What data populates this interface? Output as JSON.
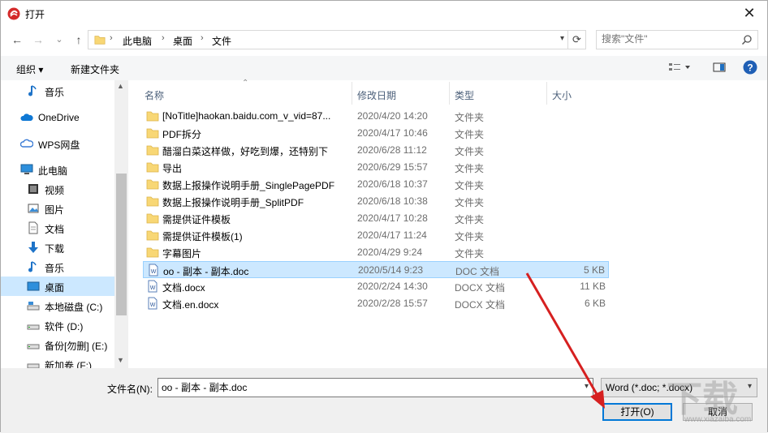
{
  "window": {
    "title": "打开",
    "close_glyph": "✕"
  },
  "nav_buttons": {
    "back": "←",
    "forward": "→",
    "recent": "⌄",
    "up": "↑"
  },
  "breadcrumb": [
    "此电脑",
    "桌面",
    "文件"
  ],
  "breadcrumb_sep": "›",
  "search": {
    "placeholder": "搜索\"文件\""
  },
  "toolbar": {
    "organize": "组织 ▾",
    "new_folder": "新建文件夹"
  },
  "nav_items": [
    {
      "label": "音乐",
      "icon": "music-icon"
    },
    {
      "label": "OneDrive",
      "icon": "cloud-icon"
    },
    {
      "label": "WPS网盘",
      "icon": "wps-cloud-icon"
    },
    {
      "label": "此电脑",
      "icon": "computer-icon"
    },
    {
      "label": "视频",
      "icon": "video-icon"
    },
    {
      "label": "图片",
      "icon": "pictures-icon"
    },
    {
      "label": "文档",
      "icon": "documents-icon"
    },
    {
      "label": "下载",
      "icon": "download-icon"
    },
    {
      "label": "音乐",
      "icon": "music-icon"
    },
    {
      "label": "桌面",
      "icon": "desktop-icon",
      "selected": true
    },
    {
      "label": "本地磁盘 (C:)",
      "icon": "drive-icon"
    },
    {
      "label": "软件 (D:)",
      "icon": "drive-icon"
    },
    {
      "label": "备份[勿删] (E:)",
      "icon": "drive-icon"
    },
    {
      "label": "新加卷 (F:)",
      "icon": "drive-icon"
    }
  ],
  "columns": {
    "name": "名称",
    "modified": "修改日期",
    "type": "类型",
    "size": "大小"
  },
  "files": [
    {
      "name": "[NoTitle]haokan.baidu.com_v_vid=87...",
      "date": "2020/4/20 14:20",
      "type": "文件夹",
      "size": "",
      "kind": "folder"
    },
    {
      "name": "PDF拆分",
      "date": "2020/4/17 10:46",
      "type": "文件夹",
      "size": "",
      "kind": "folder"
    },
    {
      "name": "醋溜白菜这样做，好吃到爆，还特别下",
      "date": "2020/6/28 11:12",
      "type": "文件夹",
      "size": "",
      "kind": "folder"
    },
    {
      "name": "导出",
      "date": "2020/6/29 15:57",
      "type": "文件夹",
      "size": "",
      "kind": "folder"
    },
    {
      "name": "数据上报操作说明手册_SinglePagePDF",
      "date": "2020/6/18 10:37",
      "type": "文件夹",
      "size": "",
      "kind": "folder"
    },
    {
      "name": "数据上报操作说明手册_SplitPDF",
      "date": "2020/6/18 10:38",
      "type": "文件夹",
      "size": "",
      "kind": "folder"
    },
    {
      "name": "需提供证件模板",
      "date": "2020/4/17 10:28",
      "type": "文件夹",
      "size": "",
      "kind": "folder"
    },
    {
      "name": "需提供证件模板(1)",
      "date": "2020/4/17 11:24",
      "type": "文件夹",
      "size": "",
      "kind": "folder"
    },
    {
      "name": "字幕图片",
      "date": "2020/4/29 9:24",
      "type": "文件夹",
      "size": "",
      "kind": "folder"
    },
    {
      "name": "oo - 副本 - 副本.doc",
      "date": "2020/5/14 9:23",
      "type": "DOC 文档",
      "size": "5 KB",
      "kind": "doc",
      "selected": true
    },
    {
      "name": "文档.docx",
      "date": "2020/2/24 14:30",
      "type": "DOCX 文档",
      "size": "11 KB",
      "kind": "doc"
    },
    {
      "name": "文档.en.docx",
      "date": "2020/2/28 15:57",
      "type": "DOCX 文档",
      "size": "6 KB",
      "kind": "doc"
    }
  ],
  "bottom": {
    "filename_label": "文件名(N):",
    "filename_value": "oo - 副本 - 副本.doc",
    "filetype": "Word (*.doc; *.docx)",
    "open_button": "打开(O)",
    "cancel_button": "取消"
  },
  "watermark": {
    "text": "下载",
    "url": "www.xiazaiba.com"
  },
  "colors": {
    "selection": "#cce8ff",
    "accent": "#0078d7",
    "folder": "#f8d775",
    "arrow": "#d62020"
  }
}
